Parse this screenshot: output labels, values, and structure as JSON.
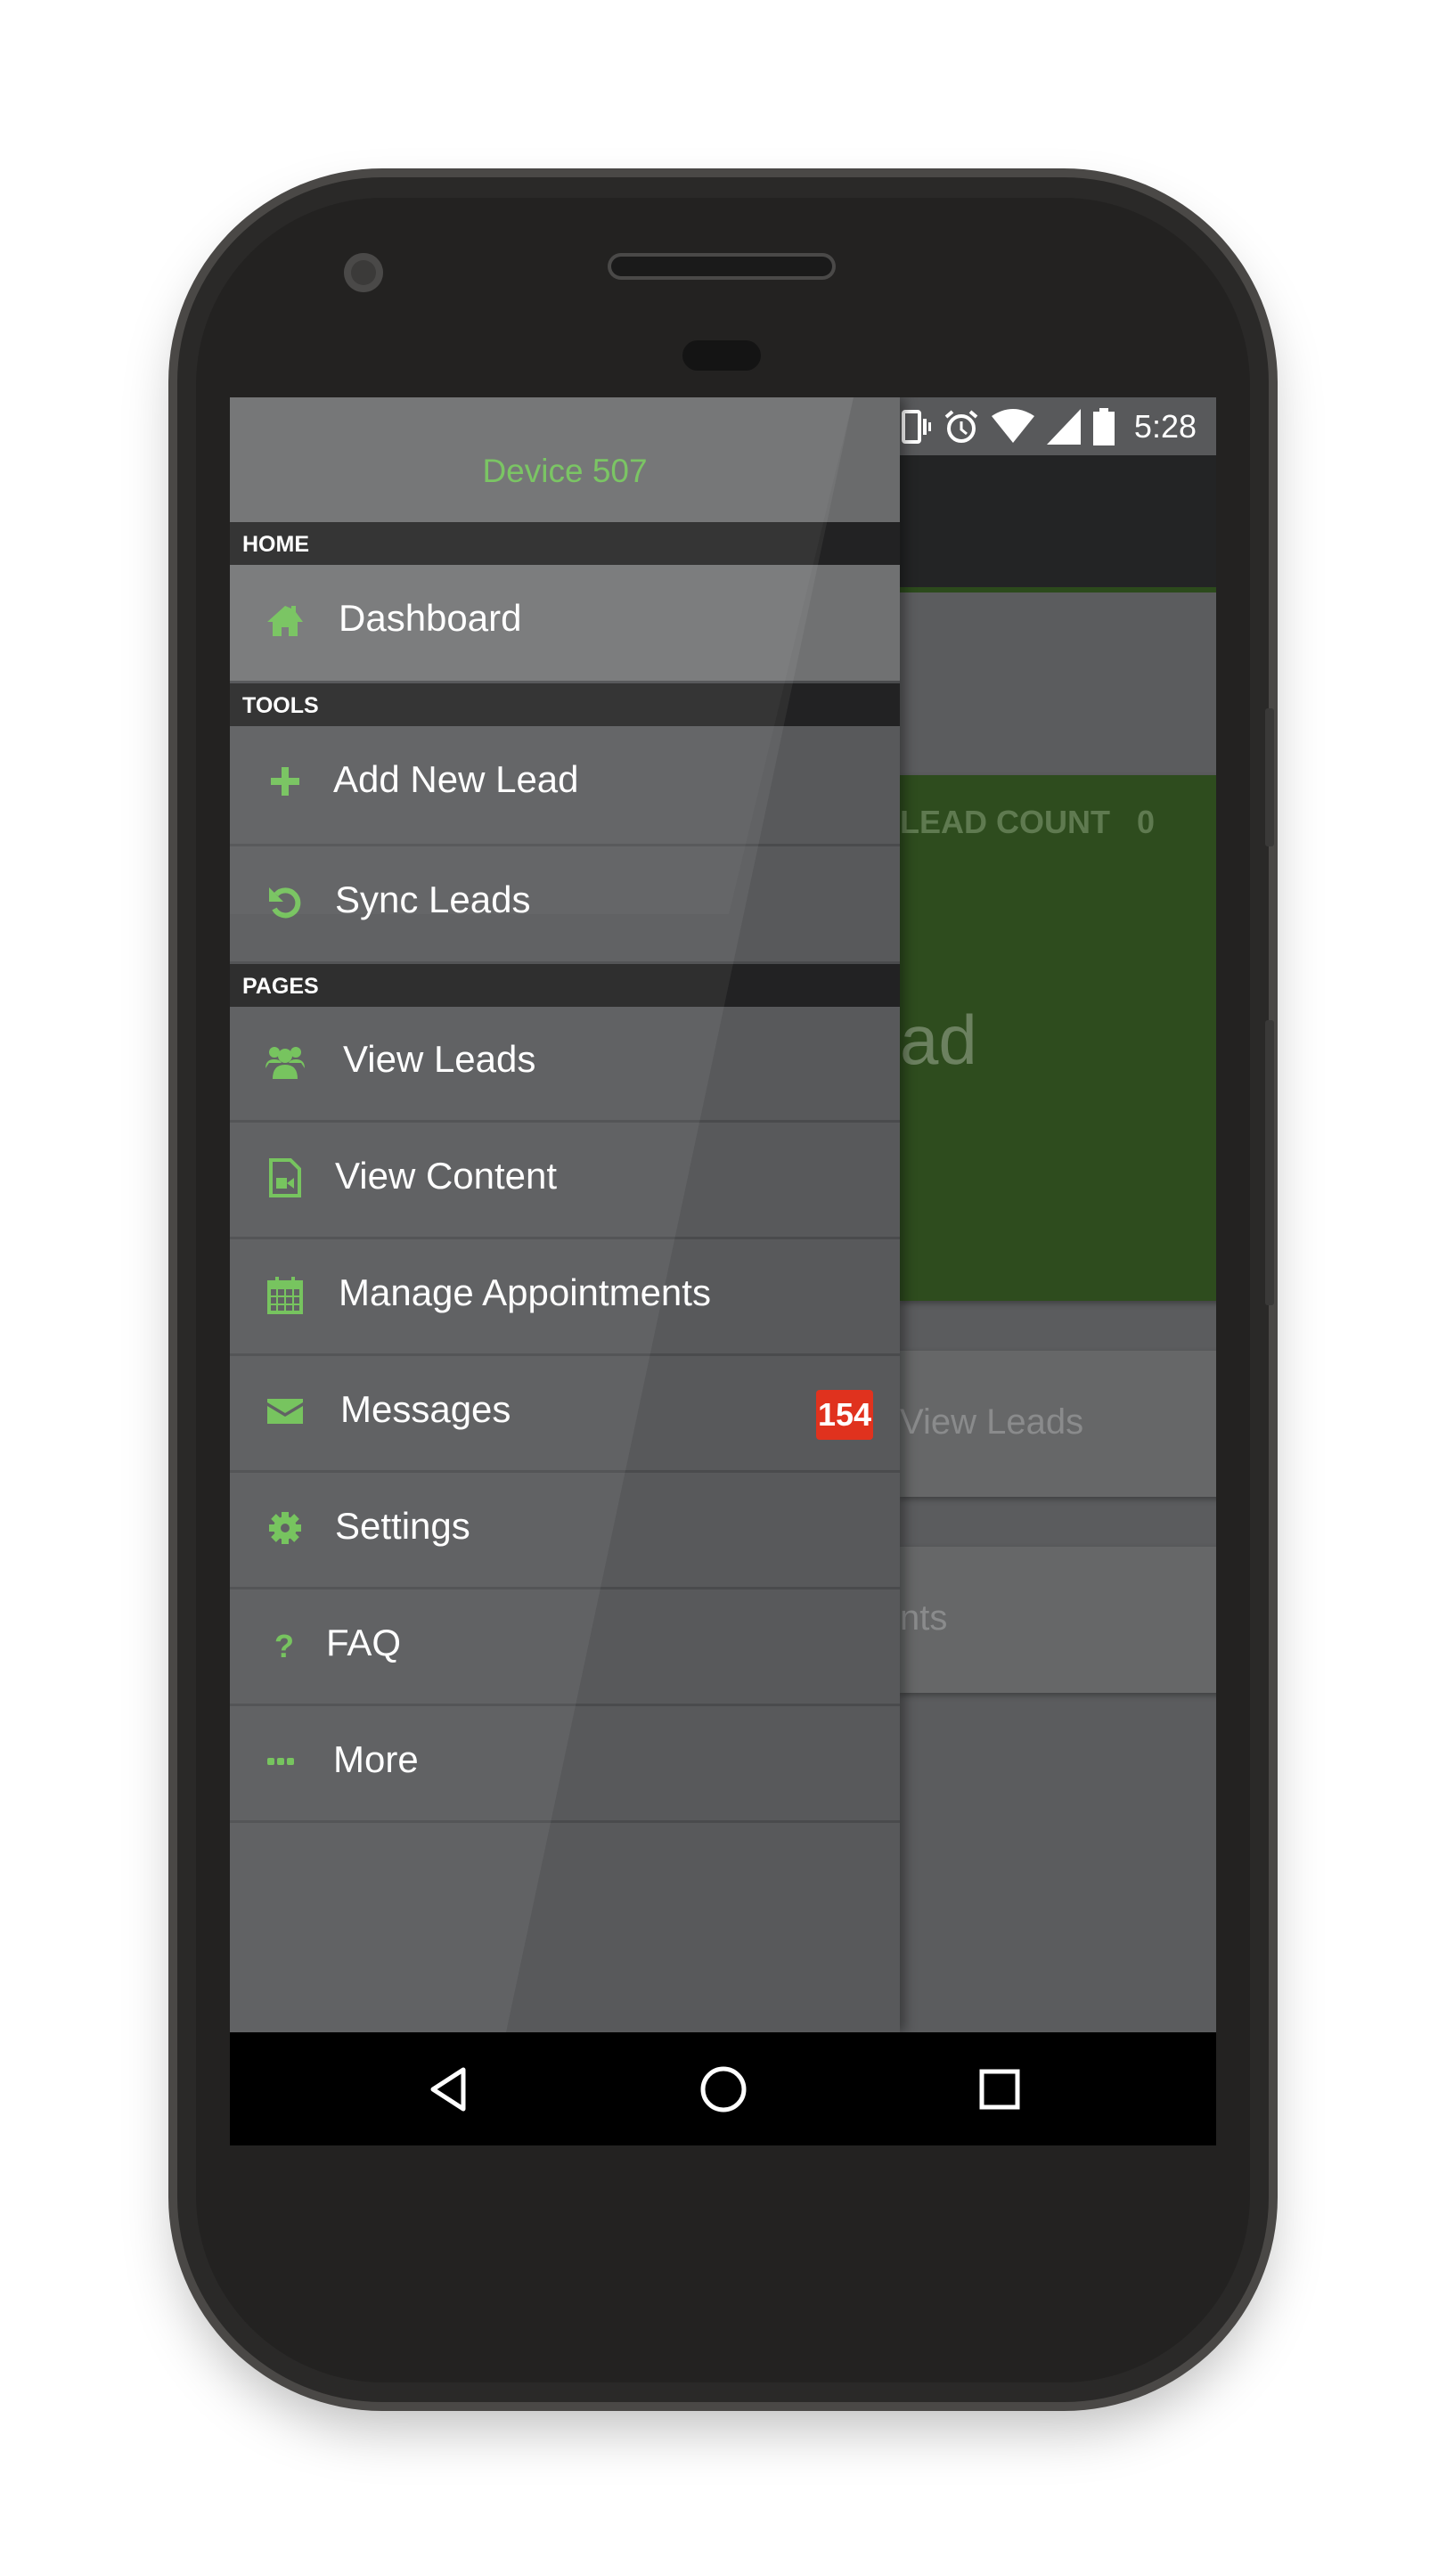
{
  "status_bar": {
    "time": "5:28",
    "icons": [
      "location-icon",
      "bluetooth-icon",
      "vibrate-icon",
      "alarm-icon",
      "wifi-icon",
      "signal-icon",
      "battery-icon"
    ]
  },
  "drawer": {
    "device_name": "Device 507",
    "sections": [
      {
        "title": "HOME"
      },
      {
        "title": "TOOLS"
      },
      {
        "title": "PAGES"
      }
    ],
    "items": [
      {
        "label": "Dashboard",
        "icon": "home-icon",
        "active": true
      },
      {
        "label": "Add New Lead",
        "icon": "plus-icon"
      },
      {
        "label": "Sync Leads",
        "icon": "sync-icon"
      },
      {
        "label": "View Leads",
        "icon": "users-icon"
      },
      {
        "label": "View Content",
        "icon": "video-file-icon"
      },
      {
        "label": "Manage Appointments",
        "icon": "calendar-icon"
      },
      {
        "label": "Messages",
        "icon": "envelope-icon",
        "badge": "154"
      },
      {
        "label": "Settings",
        "icon": "gear-icon"
      },
      {
        "label": "FAQ",
        "icon": "question-icon"
      },
      {
        "label": "More",
        "icon": "ellipsis-icon"
      }
    ]
  },
  "background": {
    "lead_count_label": "LEAD COUNT   0",
    "card_big_text": "ad",
    "view_leads_button": "View Leads",
    "appointments_button_partial": "nts"
  },
  "colors": {
    "accent": "#6fc156",
    "badge": "#e0321e",
    "card_green": "#2e4c1e"
  }
}
